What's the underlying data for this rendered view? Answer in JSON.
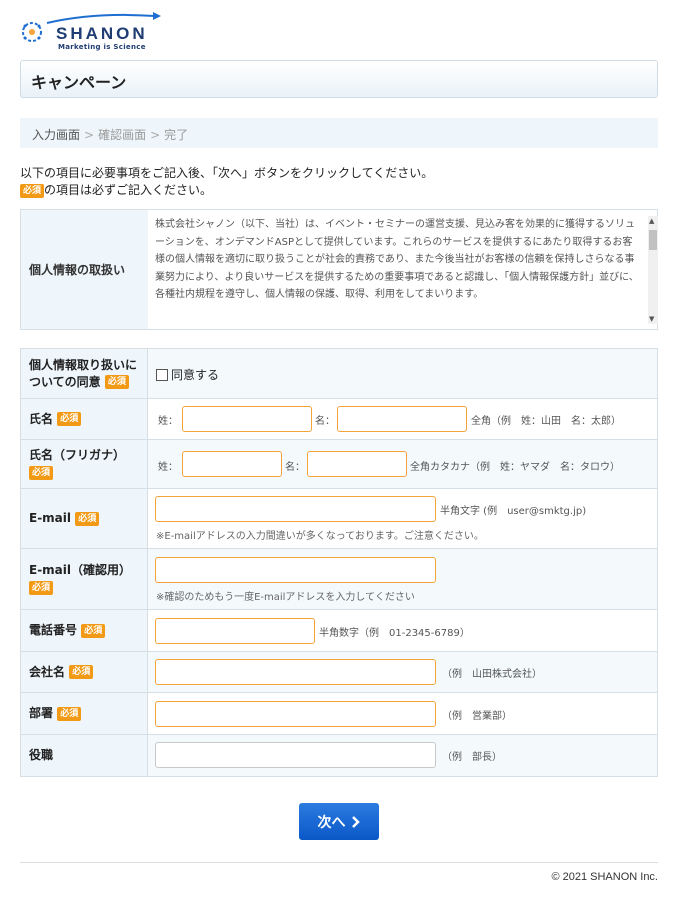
{
  "brand": {
    "name": "SHANON",
    "tagline": "Marketing is Science"
  },
  "page_title": "キャンペーン",
  "breadcrumb": {
    "step1": "入力画面",
    "sep": ">",
    "step2": "確認画面",
    "step3": "完了"
  },
  "intro": {
    "line1": "以下の項目に必要事項をご記入後、「次へ」ボタンをクリックしてください。",
    "line2": "の項目は必ずご記入ください。"
  },
  "required_badge": "必須",
  "privacy": {
    "label": "個人情報の取扱い",
    "text": "株式会社シャノン（以下、当社）は、イベント・セミナーの運営支援、見込み客を効果的に獲得するソリューションを、オンデマンドASPとして提供しています。これらのサービスを提供するにあたり取得するお客様の個人情報を適切に取り扱うことが社会的責務であり、また今後当社がお客様の信頼を保持しさらなる事業努力により、より良いサービスを提供するための重要事項であると認識し、「個人情報保護方針」並びに、各種社内規程を遵守し、個人情報の保護、取得、利用をしてまいります。"
  },
  "form": {
    "consent": {
      "label": "個人情報取り扱いについての同意",
      "checkbox_label": "同意する"
    },
    "name": {
      "label": "氏名",
      "sei": "姓：",
      "mei": "名：",
      "hint": "全角（例　姓：山田　名：太郎）"
    },
    "kana": {
      "label": "氏名（フリガナ）",
      "sei": "姓：",
      "mei": "名：",
      "hint": "全角カタカナ（例　姓：ヤマダ　名：タロウ）"
    },
    "email": {
      "label": "E-mail",
      "hint": "半角文字 (例　user@smktg.jp)",
      "note": "※E-mailアドレスの入力間違いが多くなっております。ご注意ください。"
    },
    "email_confirm": {
      "label": "E-mail（確認用）",
      "note": "※確認のためもう一度E-mailアドレスを入力してください"
    },
    "phone": {
      "label": "電話番号",
      "hint": "半角数字（例　01-2345-6789）"
    },
    "company": {
      "label": "会社名",
      "hint": "（例　山田株式会社）"
    },
    "department": {
      "label": "部署",
      "hint": "（例　営業部）"
    },
    "position": {
      "label": "役職",
      "hint": "（例　部長）"
    }
  },
  "next_button": "次へ",
  "copyright": "© 2021 SHANON Inc.",
  "colors": {
    "accent_orange": "#f29a16",
    "button_blue": "#0a58c8",
    "header_bg": "#eef6fb"
  }
}
